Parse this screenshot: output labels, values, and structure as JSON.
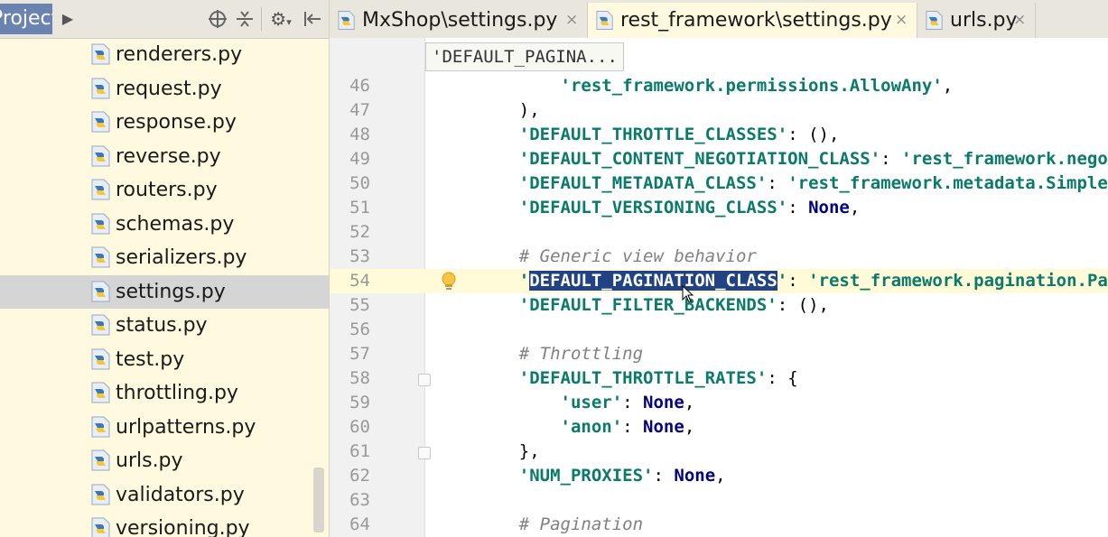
{
  "project_panel": {
    "title": "Project",
    "files": [
      {
        "name": "renderers.py"
      },
      {
        "name": "request.py"
      },
      {
        "name": "response.py"
      },
      {
        "name": "reverse.py"
      },
      {
        "name": "routers.py"
      },
      {
        "name": "schemas.py"
      },
      {
        "name": "serializers.py"
      },
      {
        "name": "settings.py",
        "selected": true
      },
      {
        "name": "status.py"
      },
      {
        "name": "test.py"
      },
      {
        "name": "throttling.py"
      },
      {
        "name": "urlpatterns.py"
      },
      {
        "name": "urls.py"
      },
      {
        "name": "validators.py"
      },
      {
        "name": "versioning.py"
      }
    ],
    "header_icons": [
      "expand-arrow-icon",
      "target-icon",
      "collapse-all-icon",
      "gear-icon",
      "hide-panel-icon"
    ]
  },
  "tabs": [
    {
      "label": "MxShop\\settings.py",
      "active": false,
      "close": "×"
    },
    {
      "label": "rest_framework\\settings.py",
      "active": true,
      "close": "×"
    },
    {
      "label": "urls.py",
      "active": false,
      "close": "×"
    }
  ],
  "editor": {
    "breadcrumb": "'DEFAULT_PAGINA...",
    "current_line": 54,
    "lines": [
      {
        "num": "46",
        "text": "        'rest_framework.permissions.AllowAny',"
      },
      {
        "num": "47",
        "text": "    ),"
      },
      {
        "num": "48",
        "text": "    'DEFAULT_THROTTLE_CLASSES': (),"
      },
      {
        "num": "49",
        "text": "    'DEFAULT_CONTENT_NEGOTIATION_CLASS': 'rest_framework.nego"
      },
      {
        "num": "50",
        "text": "    'DEFAULT_METADATA_CLASS': 'rest_framework.metadata.Simple"
      },
      {
        "num": "51",
        "text": "    'DEFAULT_VERSIONING_CLASS': None,"
      },
      {
        "num": "52",
        "text": ""
      },
      {
        "num": "53",
        "text": "    # Generic view behavior"
      },
      {
        "num": "54",
        "text": "    'DEFAULT_PAGINATION_CLASS': 'rest_framework.pagination.Pa"
      },
      {
        "num": "55",
        "text": "    'DEFAULT_FILTER_BACKENDS': (),"
      },
      {
        "num": "56",
        "text": ""
      },
      {
        "num": "57",
        "text": "    # Throttling"
      },
      {
        "num": "58",
        "text": "    'DEFAULT_THROTTLE_RATES': {"
      },
      {
        "num": "59",
        "text": "        'user': None,"
      },
      {
        "num": "60",
        "text": "        'anon': None,"
      },
      {
        "num": "61",
        "text": "    },"
      },
      {
        "num": "62",
        "text": "    'NUM_PROXIES': None,"
      },
      {
        "num": "63",
        "text": ""
      },
      {
        "num": "64",
        "text": "    # Pagination"
      }
    ],
    "selection": "DEFAULT_PAGINATION_CLASS",
    "colors": {
      "string": "#0a7a6a",
      "keyword": "#000080",
      "comment": "#808080",
      "selection": "#214283",
      "current_line": "#fffbd8"
    }
  }
}
